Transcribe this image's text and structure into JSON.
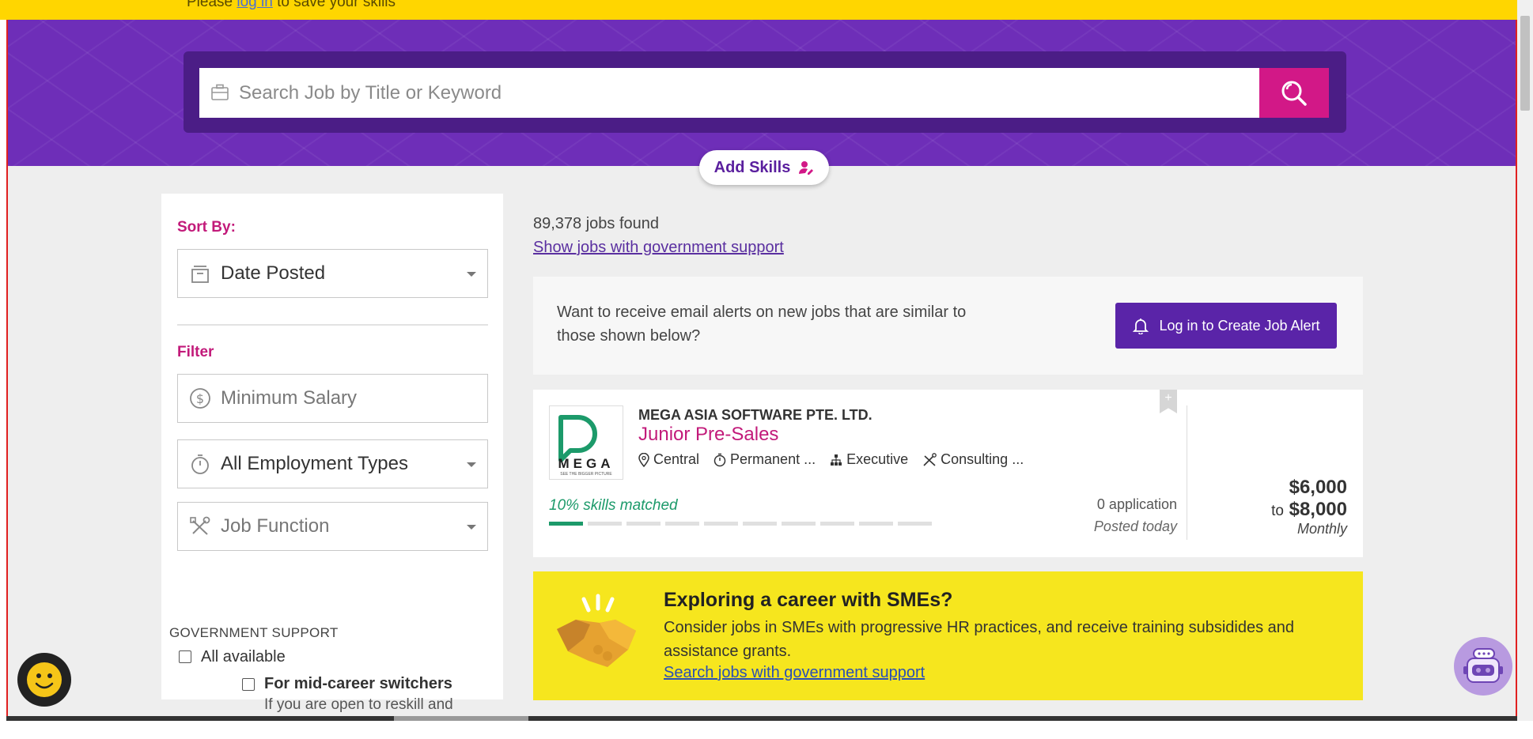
{
  "notice": {
    "before": "Please ",
    "link": "log in",
    "after": " to save your skills"
  },
  "search": {
    "placeholder": "Search Job by Title or Keyword",
    "button_icon": "search-icon"
  },
  "add_skills": {
    "label": "Add Skills",
    "icon": "person-edit-icon"
  },
  "sidebar": {
    "sort_label": "Sort By:",
    "sort_value": "Date Posted",
    "filter_label": "Filter",
    "min_salary_placeholder": "Minimum Salary",
    "employment_types": "All Employment Types",
    "job_function": "Job Function",
    "gov_support_heading": "GOVERNMENT SUPPORT",
    "all_available": "All available",
    "mid_career": "For mid-career switchers",
    "mid_career_desc": "If you are open to reskill and change careers/occupations"
  },
  "results": {
    "count": "89,378 jobs found",
    "gov_link": "Show jobs with government support"
  },
  "alert": {
    "text": "Want to receive email alerts on new jobs that are similar to those shown below?",
    "button": "Log in to Create Job Alert"
  },
  "job": {
    "company": "MEGA ASIA SOFTWARE PTE. LTD.",
    "logo_text": "MEGA",
    "logo_tagline": "SEE THE BIGGER PICTURE",
    "title": "Junior Pre-Sales",
    "location": "Central",
    "employment": "Permanent ...",
    "level": "Executive",
    "category": "Consulting ...",
    "skills_matched": "10% skills matched",
    "skills_match_fraction": 0.1,
    "applications": "0 application",
    "posted": "Posted today",
    "salary_min": "$6,000",
    "salary_to": "to",
    "salary_max": "$8,000",
    "salary_period": "Monthly"
  },
  "sme": {
    "heading": "Exploring a career with SMEs?",
    "text": "Consider jobs in SMEs with progressive HR practices, and receive training subsidides and assistance grants.",
    "link": "Search jobs with government support"
  },
  "colors": {
    "hero_purple": "#6e2eb8",
    "accent_magenta": "#d21887",
    "button_purple": "#5a24a8",
    "match_green": "#1c9a6a",
    "sme_yellow": "#f6e61e"
  }
}
